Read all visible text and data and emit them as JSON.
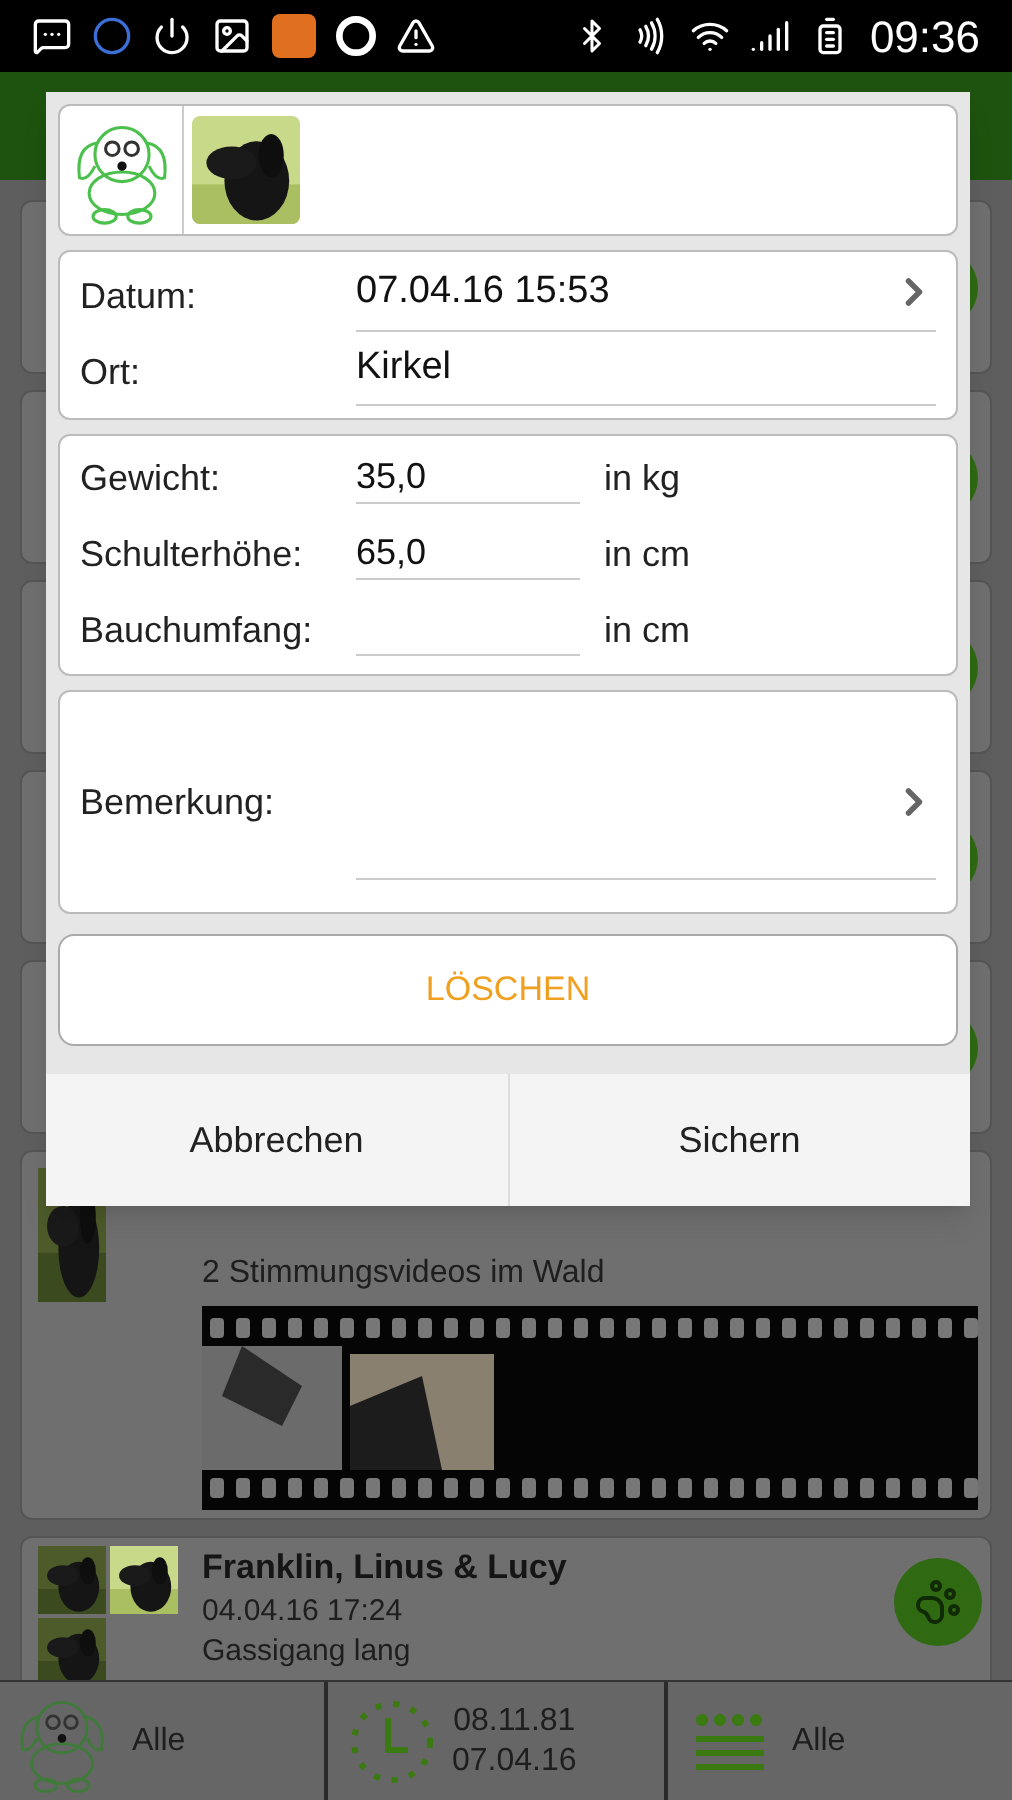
{
  "status_bar": {
    "time": "09:36"
  },
  "dialog": {
    "date_label": "Datum:",
    "date_value": "07.04.16 15:53",
    "place_label": "Ort:",
    "place_value": "Kirkel",
    "measurements": [
      {
        "label": "Gewicht:",
        "value": "35,0",
        "unit": "in kg"
      },
      {
        "label": "Schulterhöhe:",
        "value": "65,0",
        "unit": "in cm"
      },
      {
        "label": "Bauchumfang:",
        "unit": "in cm"
      }
    ],
    "remark_label": "Bemerkung:",
    "delete_button": "LÖSCHEN",
    "buttons": [
      "Abbrechen",
      "Sichern"
    ]
  },
  "video_entry": {
    "description": "2 Stimmungsvideos im Wald"
  },
  "walk_entry": {
    "title": "Franklin, Linus & Lucy",
    "date": "04.04.16 17:24",
    "description": "Gassigang lang"
  },
  "bottom_bar": {
    "dog_filter": "Alle",
    "date_from": "08.11.81",
    "date_to": "07.04.16",
    "category_filter": "Alle"
  }
}
